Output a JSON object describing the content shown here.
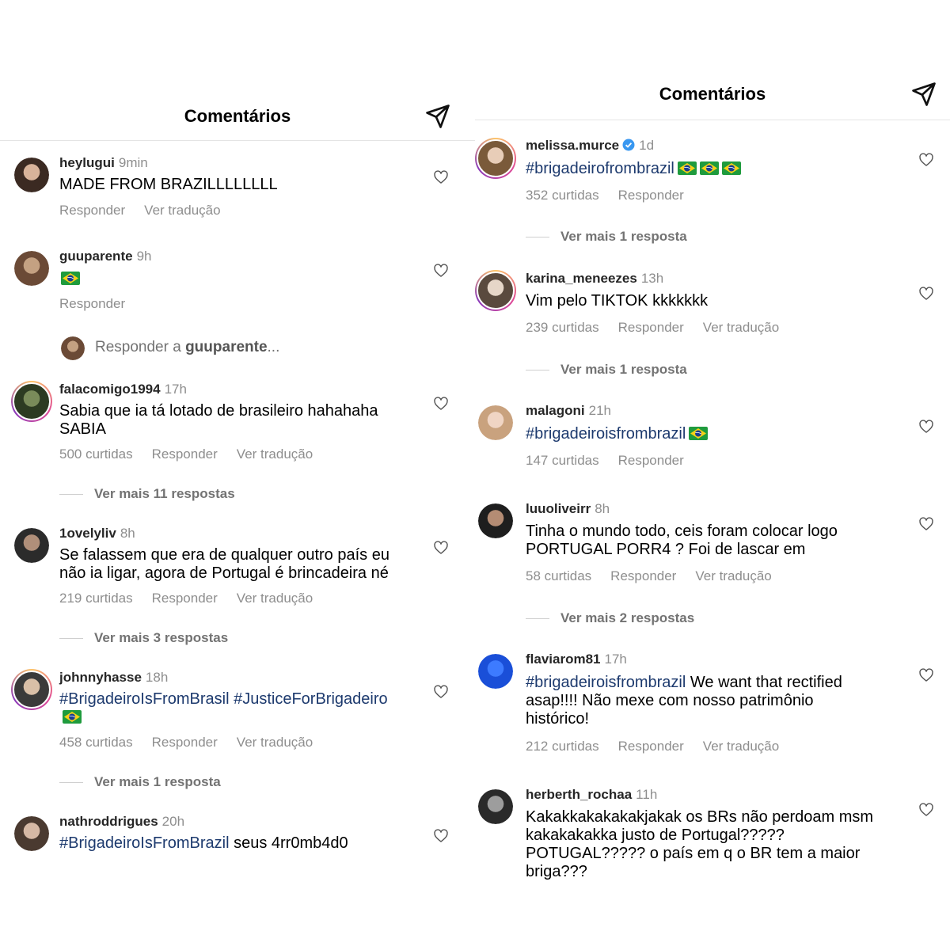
{
  "left": {
    "header": {
      "title": "Comentários"
    },
    "comments": [
      {
        "username": "heylugui",
        "time": "9min",
        "segments": [
          {
            "t": "MADE FROM BRAZILLLLLLLL",
            "h": false
          }
        ],
        "flags": 0,
        "likes": "",
        "actions": [
          "Responder",
          "Ver tradução"
        ]
      },
      {
        "username": "guuparente",
        "time": "9h",
        "segments": [],
        "flags": 1,
        "likes": "",
        "actions": [
          "Responder"
        ]
      },
      {
        "username": "falacomigo1994",
        "time": "17h",
        "segments": [
          {
            "t": "Sabia que ia tá lotado de brasileiro hahahaha\nSABIA",
            "h": false
          }
        ],
        "flags": 0,
        "likes": "500 curtidas",
        "actions": [
          "Responder",
          "Ver tradução"
        ]
      },
      {
        "username": "1ovelyliv",
        "time": "8h",
        "segments": [
          {
            "t": "Se falassem que era de qualquer outro país eu\nnão ia ligar, agora de Portugal é brincadeira né",
            "h": false
          }
        ],
        "flags": 0,
        "likes": "219 curtidas",
        "actions": [
          "Responder",
          "Ver tradução"
        ]
      },
      {
        "username": "johnnyhasse",
        "time": "18h",
        "segments": [
          {
            "t": "#BrigadeiroIsFromBrasil #JusticeForBrigadeiro",
            "h": true
          }
        ],
        "flags": 1,
        "flagsNewLine": true,
        "likes": "458 curtidas",
        "actions": [
          "Responder",
          "Ver tradução"
        ]
      },
      {
        "username": "nathroddrigues",
        "time": "20h",
        "segments": [
          {
            "t": "#BrigadeiroIsFromBrazil",
            "h": true
          },
          {
            "t": " seus 4rr0mb4d0",
            "h": false
          }
        ],
        "flags": 0,
        "likes": "",
        "actions": []
      }
    ],
    "reply_prompt": {
      "prefix": "Responder a ",
      "name": "guuparente",
      "suffix": "..."
    },
    "more_replies": [
      "Ver mais 11 respostas",
      "Ver mais 3 respostas",
      "Ver mais 1 resposta"
    ]
  },
  "right": {
    "header": {
      "title": "Comentários"
    },
    "comments": [
      {
        "username": "melissa.murce",
        "verified": true,
        "time": "1d",
        "segments": [
          {
            "t": "#brigadeirofrombrazil",
            "h": true
          }
        ],
        "flags": 3,
        "likes": "352 curtidas",
        "actions": [
          "Responder"
        ]
      },
      {
        "username": "karina_meneezes",
        "time": "13h",
        "segments": [
          {
            "t": "Vim pelo TIKTOK kkkkkkk",
            "h": false
          }
        ],
        "flags": 0,
        "likes": "239 curtidas",
        "actions": [
          "Responder",
          "Ver tradução"
        ]
      },
      {
        "username": "malagoni",
        "time": "21h",
        "segments": [
          {
            "t": "#brigadeiroisfrombrazil",
            "h": true
          }
        ],
        "flags": 1,
        "likes": "147 curtidas",
        "actions": [
          "Responder"
        ]
      },
      {
        "username": "luuoliveirr",
        "time": "8h",
        "segments": [
          {
            "t": "Tinha o mundo todo, ceis foram colocar logo\nPORTUGAL PORR4 ? Foi de lascar em",
            "h": false
          }
        ],
        "flags": 0,
        "likes": "58 curtidas",
        "actions": [
          "Responder",
          "Ver tradução"
        ]
      },
      {
        "username": "flaviarom81",
        "time": "17h",
        "segments": [
          {
            "t": "#brigadeiroisfrombrazil",
            "h": true
          },
          {
            "t": " We want that rectified\nasap!!!! Não mexe com nosso patrimônio\nhistórico!",
            "h": false
          }
        ],
        "flags": 0,
        "likes": "212 curtidas",
        "actions": [
          "Responder",
          "Ver tradução"
        ]
      },
      {
        "username": "herberth_rochaa",
        "time": "11h",
        "segments": [
          {
            "t": "Kakakkakakakakjakak os BRs não perdoam msm\nkakakakakka justo de Portugal?????\nPOTUGAL????? o país em q o BR tem a maior\nbriga???",
            "h": false
          }
        ],
        "flags": 0,
        "likes": "",
        "actions": []
      }
    ],
    "more_replies": [
      "Ver mais 1 resposta",
      "Ver mais 1 resposta",
      "Ver mais 2 respostas"
    ]
  },
  "colors": {
    "hashtag": "#1d3a6e",
    "muted": "#8e8e8e",
    "verified": "#3897f0",
    "ring": "#e1306c"
  },
  "icons": [
    "send-icon",
    "heart-icon",
    "verified-badge-icon",
    "brazil-flag-icon"
  ]
}
